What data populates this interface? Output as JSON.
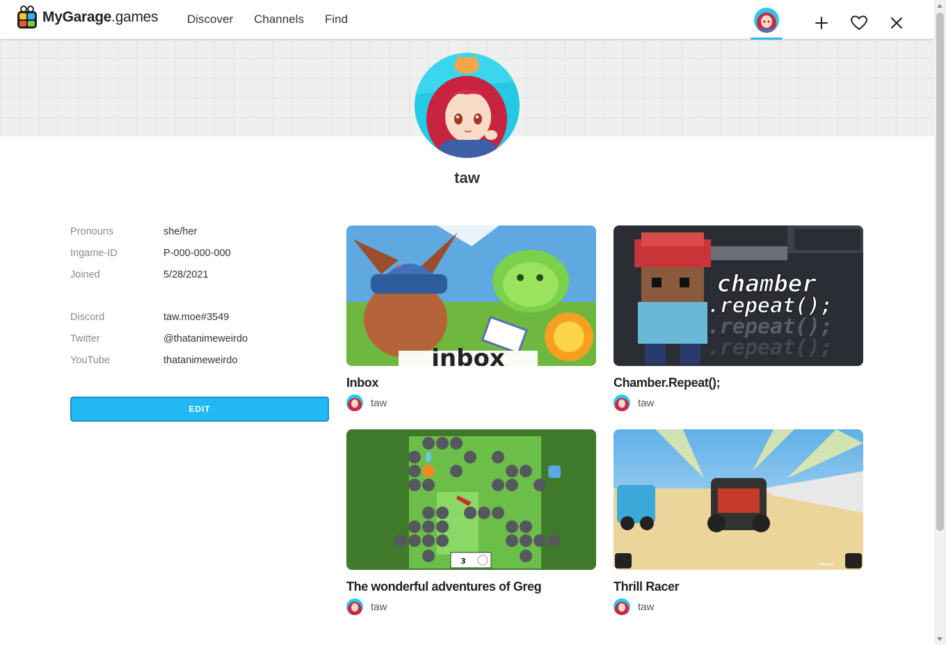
{
  "brand": {
    "name_bold": "MyGarage",
    "name_rest": ".games"
  },
  "nav": {
    "items": [
      "Discover",
      "Channels",
      "Find"
    ]
  },
  "profile": {
    "username": "taw"
  },
  "info": {
    "pronouns_label": "Pronouns",
    "pronouns_value": "she/her",
    "ingame_label": "Ingame-ID",
    "ingame_value": "P-000-000-000",
    "joined_label": "Joined",
    "joined_value": "5/28/2021",
    "discord_label": "Discord",
    "discord_value": "taw.moe#3549",
    "twitter_label": "Twitter",
    "twitter_value": "@thatanimeweirdo",
    "youtube_label": "YouTube",
    "youtube_value": "thatanimeweirdo"
  },
  "edit_label": "EDIT",
  "games": [
    {
      "title": "Inbox",
      "author": "taw",
      "thumb_text": "inbox"
    },
    {
      "title": "Chamber.Repeat();",
      "author": "taw",
      "thumb_text_1": "chamber",
      "thumb_text_2": ".repeat();"
    },
    {
      "title": "The wonderful adventures of Greg",
      "author": "taw",
      "thumb_text": "3"
    },
    {
      "title": "Thrill Racer",
      "author": "taw",
      "thumb_text": "Pause"
    }
  ],
  "colors": {
    "accent": "#22b8f5",
    "banner": "#efefef"
  },
  "icons": [
    "logo-icon",
    "plus-icon",
    "heart-icon",
    "close-icon"
  ]
}
